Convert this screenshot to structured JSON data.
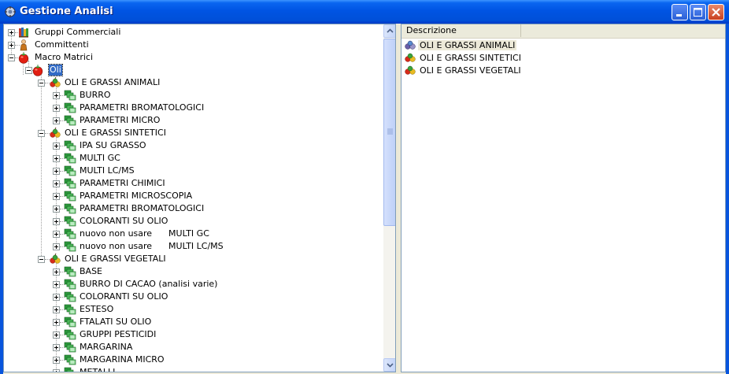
{
  "window": {
    "title": "Gestione Analisi"
  },
  "list": {
    "column": "Descrizione",
    "rows": [
      {
        "label": "OLI E GRASSI ANIMALI",
        "selected": true
      },
      {
        "label": "OLI E GRASSI SINTETICI",
        "selected": false
      },
      {
        "label": "OLI E GRASSI VEGETALI",
        "selected": false
      }
    ]
  },
  "tree": {
    "nodes": [
      {
        "label": "Gruppi Commerciali",
        "level": 0,
        "icon": "books-icon",
        "expander": "plus"
      },
      {
        "label": "Committenti",
        "level": 0,
        "icon": "person-icon",
        "expander": "plus"
      },
      {
        "label": "Macro Matrici",
        "level": 0,
        "icon": "tomato-icon",
        "expander": "minus"
      },
      {
        "label": "Oli",
        "level": 1,
        "icon": "tomato-icon",
        "expander": "minus",
        "selected": true
      },
      {
        "label": "OLI E GRASSI ANIMALI",
        "level": 2,
        "icon": "fruits-icon",
        "expander": "minus"
      },
      {
        "label": "BURRO",
        "level": 3,
        "icon": "folders-icon",
        "expander": "plus"
      },
      {
        "label": "PARAMETRI BROMATOLOGICI",
        "level": 3,
        "icon": "folders-icon",
        "expander": "plus"
      },
      {
        "label": "PARAMETRI MICRO",
        "level": 3,
        "icon": "folders-icon",
        "expander": "plus"
      },
      {
        "label": "OLI E GRASSI SINTETICI",
        "level": 2,
        "icon": "fruits-icon",
        "expander": "minus"
      },
      {
        "label": "IPA SU GRASSO",
        "level": 3,
        "icon": "folders-icon",
        "expander": "plus"
      },
      {
        "label": "MULTI GC",
        "level": 3,
        "icon": "folders-icon",
        "expander": "plus"
      },
      {
        "label": "MULTI LC/MS",
        "level": 3,
        "icon": "folders-icon",
        "expander": "plus"
      },
      {
        "label": "PARAMETRI CHIMICI",
        "level": 3,
        "icon": "folders-icon",
        "expander": "plus"
      },
      {
        "label": "PARAMETRI MICROSCOPIA",
        "level": 3,
        "icon": "folders-icon",
        "expander": "plus"
      },
      {
        "label": "PARAMETRI BROMATOLOGICI",
        "level": 3,
        "icon": "folders-icon",
        "expander": "plus"
      },
      {
        "label": "COLORANTI SU OLIO",
        "level": 3,
        "icon": "folders-icon",
        "expander": "plus"
      },
      {
        "label": "nuovo non usare      MULTI GC",
        "level": 3,
        "icon": "folders-icon",
        "expander": "plus"
      },
      {
        "label": "nuovo non usare      MULTI LC/MS",
        "level": 3,
        "icon": "folders-icon",
        "expander": "plus"
      },
      {
        "label": "OLI E GRASSI VEGETALI",
        "level": 2,
        "icon": "fruits-icon",
        "expander": "minus"
      },
      {
        "label": "BASE",
        "level": 3,
        "icon": "folders-icon",
        "expander": "plus"
      },
      {
        "label": "BURRO DI CACAO (analisi varie)",
        "level": 3,
        "icon": "folders-icon",
        "expander": "plus"
      },
      {
        "label": "COLORANTI SU OLIO",
        "level": 3,
        "icon": "folders-icon",
        "expander": "plus"
      },
      {
        "label": "ESTESO",
        "level": 3,
        "icon": "folders-icon",
        "expander": "plus"
      },
      {
        "label": "FTALATI SU OLIO",
        "level": 3,
        "icon": "folders-icon",
        "expander": "plus"
      },
      {
        "label": "GRUPPI PESTICIDI",
        "level": 3,
        "icon": "folders-icon",
        "expander": "plus"
      },
      {
        "label": "MARGARINA",
        "level": 3,
        "icon": "folders-icon",
        "expander": "plus"
      },
      {
        "label": "MARGARINA MICRO",
        "level": 3,
        "icon": "folders-icon",
        "expander": "plus"
      },
      {
        "label": "METALLI",
        "level": 3,
        "icon": "folders-icon",
        "expander": "plus"
      }
    ]
  }
}
